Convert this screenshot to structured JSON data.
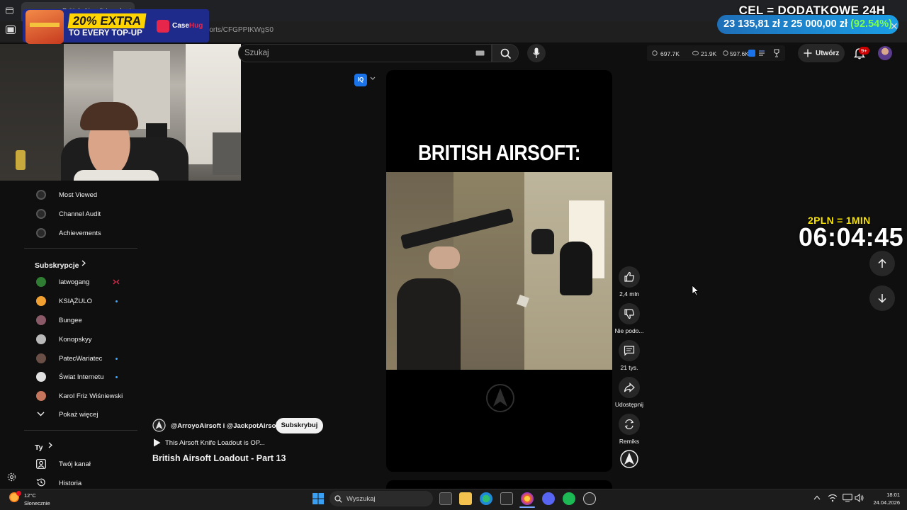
{
  "browser": {
    "tab_title": "British Airsoft Loadout",
    "url": "/shorts/CFGPPIKWgS0"
  },
  "overlay_ad": {
    "headline": "20% EXTRA",
    "subline": "TO EVERY TOP-UP",
    "brand_prefix": "Case",
    "brand_suffix": "Hug"
  },
  "overlay_goal": {
    "title": "CEL = DODATKOWE 24H",
    "current": "23 135,81 zł",
    "sep": "z",
    "target": "25 000,00 zł",
    "percent": "(92.54%)",
    "close": "✕"
  },
  "overlay_timer": {
    "rate": "2PLN = 1MIN",
    "time": "06:04:45"
  },
  "header": {
    "search_placeholder": "Szukaj",
    "stats": [
      "697.7K",
      "21.9K",
      "597.6K"
    ],
    "create_label": "Utwórz",
    "notifications_badge": "9+"
  },
  "sidebar": {
    "top_items": [
      {
        "label": "Most Viewed",
        "icon": "vidiq-icon"
      },
      {
        "label": "Channel Audit",
        "icon": "vidiq-icon"
      },
      {
        "label": "Achievements",
        "icon": "vidiq-icon"
      }
    ],
    "subscriptions_heading": "Subskrypcje",
    "subscriptions": [
      {
        "label": "latwogang",
        "avatar_color": "#2f7d32",
        "indicator": "live"
      },
      {
        "label": "KSIĄŻULO",
        "avatar_color": "#f0a030",
        "indicator": "new"
      },
      {
        "label": "Bungee",
        "avatar_color": "#8a5a68",
        "indicator": "none"
      },
      {
        "label": "Konopskyy",
        "avatar_color": "#b9b9b9",
        "indicator": "none"
      },
      {
        "label": "PatecWariatec",
        "avatar_color": "#6a4f46",
        "indicator": "new"
      },
      {
        "label": "Świat Internetu",
        "avatar_color": "#e0e0e0",
        "indicator": "new"
      },
      {
        "label": "Karol Friz Wiśniewski",
        "avatar_color": "#c5755b",
        "indicator": "none"
      }
    ],
    "show_more": "Pokaż więcej",
    "you_heading": "Ty",
    "you_items": [
      {
        "label": "Twój kanał",
        "icon": "account-box-icon"
      },
      {
        "label": "Historia",
        "icon": "history-icon"
      }
    ]
  },
  "short": {
    "headline": "BRITISH AIRSOFT:",
    "channel": "@ArroyoAirsoft i @JackpotAirsoft",
    "subscribe": "Subskrybuj",
    "playlist": "This Airsoft Knife Loadout is OP...",
    "title": "British Airsoft Loadout - Part 13",
    "iq_label": "IQ",
    "actions": [
      {
        "id": "like",
        "label": "2,4 mln"
      },
      {
        "id": "dislike",
        "label": "Nie podo..."
      },
      {
        "id": "comments",
        "label": "21 tys."
      },
      {
        "id": "share",
        "label": "Udostępnij"
      },
      {
        "id": "remix",
        "label": "Remiks"
      }
    ]
  },
  "taskbar": {
    "weather_temp": "12°C",
    "weather_desc": "Słonecznie",
    "search_label": "Wyszukaj",
    "time": "18:01",
    "date": "24.04.2026"
  }
}
